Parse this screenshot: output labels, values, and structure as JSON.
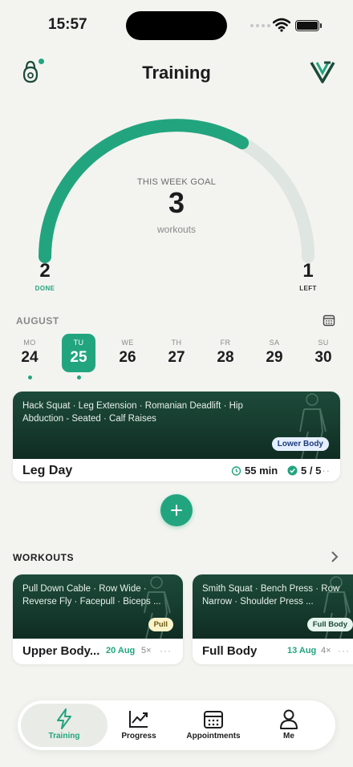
{
  "status_bar": {
    "time": "15:57"
  },
  "header": {
    "title": "Training"
  },
  "goal": {
    "label": "THIS WEEK GOAL",
    "value": "3",
    "unit": "workouts",
    "done_value": "2",
    "done_label": "DONE",
    "left_value": "1",
    "left_label": "LEFT",
    "progress_fraction": 0.667
  },
  "calendar": {
    "month": "AUGUST",
    "days": [
      {
        "name": "MO",
        "date": "24",
        "active": false,
        "dot": true
      },
      {
        "name": "TU",
        "date": "25",
        "active": true,
        "dot": true
      },
      {
        "name": "WE",
        "date": "26",
        "active": false,
        "dot": false
      },
      {
        "name": "TH",
        "date": "27",
        "active": false,
        "dot": false
      },
      {
        "name": "FR",
        "date": "28",
        "active": false,
        "dot": false
      },
      {
        "name": "SA",
        "date": "29",
        "active": false,
        "dot": false
      },
      {
        "name": "SU",
        "date": "30",
        "active": false,
        "dot": false
      }
    ]
  },
  "today_workout": {
    "exercises": "Hack Squat · Leg Extension · Romanian Deadlift · Hip Abduction - Seated · Calf Raises",
    "tag": "Lower Body",
    "title": "Leg Day",
    "duration": "55 min",
    "completed": "5 / 5",
    "more": "···"
  },
  "workouts": {
    "section_title": "WORKOUTS",
    "items": [
      {
        "exercises": "Pull Down Cable · Row Wide · Reverse Fly · Facepull · Biceps ...",
        "tag": "Pull",
        "title": "Upper Body...",
        "date": "20 Aug",
        "count": "5×",
        "more": "···"
      },
      {
        "exercises": "Smith Squat · Bench Press · Row Narrow · Shoulder Press ...",
        "tag": "Full Body",
        "title": "Full Body",
        "date": "13 Aug",
        "count": "4×",
        "more": "···"
      }
    ]
  },
  "tabbar": {
    "items": [
      {
        "label": "Training",
        "icon": "bolt-icon",
        "active": true
      },
      {
        "label": "Progress",
        "icon": "chart-icon",
        "active": false
      },
      {
        "label": "Appointments",
        "icon": "calendar-icon",
        "active": false
      },
      {
        "label": "Me",
        "icon": "person-icon",
        "active": false
      }
    ]
  },
  "colors": {
    "accent": "#22a57f",
    "track": "#dfe5e1",
    "card_dark": "#1d4a3a",
    "tag_pull": "#fbf3c9",
    "tag_lower": "#e6efff",
    "tag_full": "#e6f5ee"
  }
}
